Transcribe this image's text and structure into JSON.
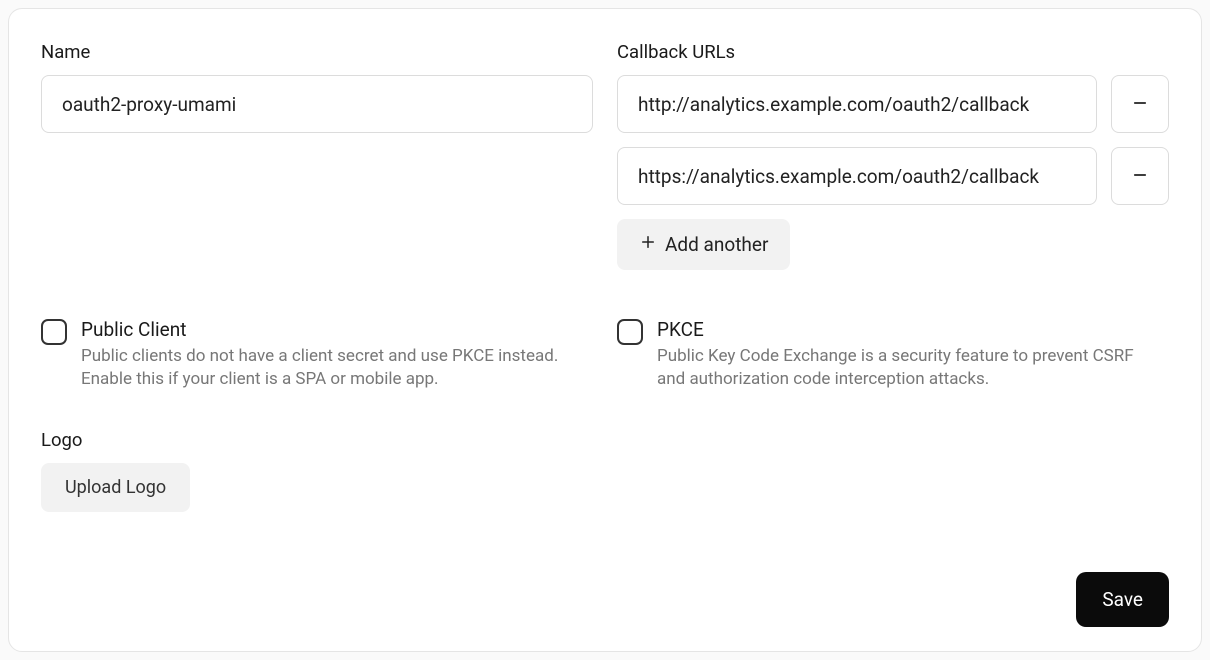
{
  "name": {
    "label": "Name",
    "value": "oauth2-proxy-umami"
  },
  "callback": {
    "label": "Callback URLs",
    "urls": [
      "http://analytics.example.com/oauth2/callback",
      "https://analytics.example.com/oauth2/callback"
    ],
    "add_label": "Add another"
  },
  "public_client": {
    "label": "Public Client",
    "desc": "Public clients do not have a client secret and use PKCE instead. Enable this if your client is a SPA or mobile app.",
    "checked": false
  },
  "pkce": {
    "label": "PKCE",
    "desc": "Public Key Code Exchange is a security feature to prevent CSRF and authorization code interception attacks.",
    "checked": false
  },
  "logo": {
    "label": "Logo",
    "button": "Upload Logo"
  },
  "actions": {
    "save": "Save"
  }
}
